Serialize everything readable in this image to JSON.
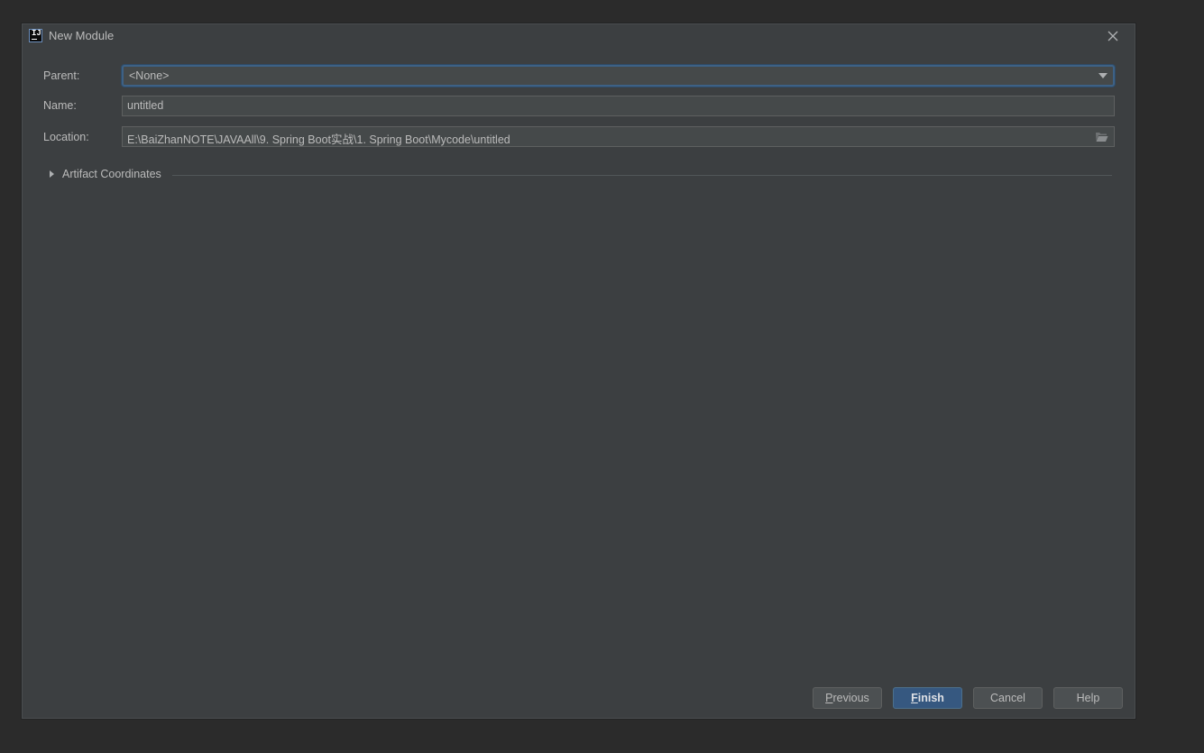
{
  "window": {
    "title": "New Module",
    "app_icon_text": "IJ"
  },
  "form": {
    "parent_label": "Parent:",
    "parent_value": "<None>",
    "name_label": "Name:",
    "name_value": "untitled",
    "location_label": "Location:",
    "location_value": "E:\\BaiZhanNOTE\\JAVAAll\\9.  Spring Boot实战\\1. Spring Boot\\Mycode\\untitled"
  },
  "section": {
    "artifact_label": "Artifact Coordinates",
    "expanded": false
  },
  "buttons": {
    "previous_mnemonic": "P",
    "previous_rest": "revious",
    "finish_mnemonic": "F",
    "finish_rest": "inish",
    "cancel": "Cancel",
    "help": "Help"
  },
  "icons": {
    "app": "intellij-idea-icon",
    "close": "close-icon",
    "dropdown": "chevron-down-icon",
    "browse": "folder-open-icon",
    "expand": "triangle-right-icon"
  },
  "colors": {
    "background": "#2b2b2b",
    "dialog": "#3c3f41",
    "field": "#45494a",
    "focus_border": "#3d6185",
    "default_button": "#365880",
    "text": "#bbbbbb"
  }
}
